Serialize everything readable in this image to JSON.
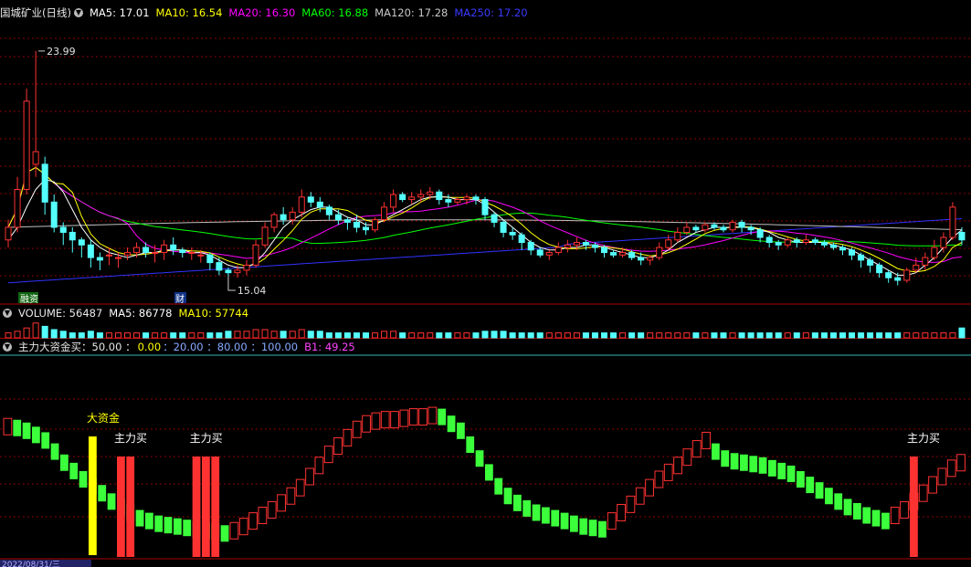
{
  "colors": {
    "up": "#ff3232",
    "down": "#54ffff",
    "ma5": "#ffffff",
    "ma10": "#ffff00",
    "ma20": "#ff00ff",
    "ma60": "#00ff00",
    "ma120": "#c0c0c0",
    "ma250": "#3232ff",
    "bull": "#ff3232",
    "bear": "#3cff3c",
    "bigfund": "#ffff00"
  },
  "header": {
    "title": "国城矿业(日线)",
    "ma5": "MA5: 17.01",
    "ma10": "MA10: 16.54",
    "ma20": "MA20: 16.30",
    "ma60": "MA60: 16.88",
    "ma120": "MA120: 17.28",
    "ma250": "MA250: 17.20"
  },
  "annotations": {
    "high": "23.99",
    "low": "15.04",
    "tag1": "融资",
    "tag2": "财"
  },
  "volume_header": {
    "label": "VOLUME: 56487",
    "ma5": "MA5: 86778",
    "ma10": "MA10: 57744"
  },
  "indicator_header": {
    "label": "主力大资金买：50.00 ：",
    "v1": "0.00",
    "v2": "：20.00 ：80.00 ：100.00",
    "b1": "B1: 49.25"
  },
  "indicator_labels": {
    "big": "大资金",
    "buy": "主力买"
  },
  "axis": {
    "date": "2022/08/31/三"
  },
  "chart_data": [
    {
      "type": "candlestick",
      "ylim": [
        14.5,
        25
      ],
      "candles": [
        [
          16.5,
          17,
          16.2,
          17.3
        ],
        [
          17,
          18.5,
          16.8,
          19
        ],
        [
          18.5,
          22,
          18.3,
          22.5
        ],
        [
          19.5,
          20,
          19,
          23.99
        ],
        [
          19.5,
          18,
          17.5,
          19.8
        ],
        [
          18,
          17,
          16.8,
          18.3
        ],
        [
          17,
          16.8,
          16.3,
          17.2
        ],
        [
          16.8,
          16.5,
          16,
          17
        ],
        [
          16.5,
          16.3,
          15.8,
          16.6
        ],
        [
          16.3,
          15.8,
          15.4,
          16.5
        ],
        [
          15.8,
          15.7,
          15.3,
          16
        ],
        [
          15.9,
          15.9,
          15.5,
          16.2
        ],
        [
          15.8,
          15.8,
          15.4,
          16
        ],
        [
          15.9,
          16,
          15.7,
          16.2
        ],
        [
          16,
          16.2,
          15.8,
          16.4
        ],
        [
          16.2,
          16,
          15.8,
          16.4
        ],
        [
          16,
          16,
          15.6,
          16.3
        ],
        [
          16,
          16.3,
          15.7,
          16.5
        ],
        [
          16.3,
          16.1,
          15.9,
          16.6
        ],
        [
          16.1,
          16,
          15.8,
          16.2
        ],
        [
          16,
          16,
          15.7,
          16.2
        ],
        [
          15.9,
          15.9,
          15.6,
          16.1
        ],
        [
          15.9,
          15.6,
          15.3,
          16
        ],
        [
          15.6,
          15.3,
          15.1,
          15.8
        ],
        [
          15.3,
          15.2,
          15.04,
          15.4
        ],
        [
          15.2,
          15.3,
          15,
          15.5
        ],
        [
          15.3,
          15.5,
          15.1,
          15.7
        ],
        [
          15.5,
          16.3,
          15.4,
          16.5
        ],
        [
          16.3,
          17,
          16.2,
          17.2
        ],
        [
          17,
          17.5,
          16.8,
          17.6
        ],
        [
          17.5,
          17.3,
          17.1,
          17.8
        ],
        [
          17.3,
          17.6,
          17.1,
          17.8
        ],
        [
          17.6,
          18.2,
          17.4,
          18.5
        ],
        [
          18.2,
          18,
          17.8,
          18.4
        ],
        [
          18,
          17.8,
          17.6,
          18.2
        ],
        [
          17.8,
          17.5,
          17.3,
          17.9
        ],
        [
          17.5,
          17.3,
          17.1,
          17.7
        ],
        [
          17.3,
          17.2,
          16.9,
          17.4
        ],
        [
          17.2,
          17,
          16.8,
          17.5
        ],
        [
          17,
          16.9,
          16.7,
          17.2
        ],
        [
          16.9,
          17.3,
          16.8,
          17.4
        ],
        [
          17.3,
          17.8,
          17.2,
          18
        ],
        [
          17.8,
          18.3,
          17.6,
          18.5
        ],
        [
          18.3,
          18.1,
          18,
          18.4
        ],
        [
          18.1,
          18.2,
          17.9,
          18.4
        ],
        [
          18.2,
          18.3,
          18,
          18.5
        ],
        [
          18.3,
          18.4,
          18.1,
          18.6
        ],
        [
          18.4,
          18.1,
          17.9,
          18.5
        ],
        [
          18.1,
          18,
          17.8,
          18.3
        ],
        [
          18,
          18.1,
          17.9,
          18.2
        ],
        [
          18.1,
          18.2,
          17.9,
          18.3
        ],
        [
          18.2,
          18.1,
          17.9,
          18.3
        ],
        [
          18.1,
          17.5,
          17.3,
          18.2
        ],
        [
          17.5,
          17.2,
          17,
          17.6
        ],
        [
          17.2,
          16.8,
          16.6,
          17.3
        ],
        [
          16.8,
          16.7,
          16.5,
          17
        ],
        [
          16.7,
          16.4,
          16.1,
          16.8
        ],
        [
          16.4,
          16.1,
          15.9,
          16.5
        ],
        [
          16.1,
          15.9,
          15.8,
          16.2
        ],
        [
          15.9,
          16,
          15.7,
          16.1
        ],
        [
          16,
          16.2,
          15.9,
          16.4
        ],
        [
          16.2,
          16.3,
          16,
          16.5
        ],
        [
          16.3,
          16.4,
          16.1,
          16.6
        ],
        [
          16.4,
          16.3,
          16.1,
          16.5
        ],
        [
          16.3,
          16.2,
          16,
          16.4
        ],
        [
          16.2,
          16,
          15.8,
          16.3
        ],
        [
          16,
          15.9,
          15.8,
          16.1
        ],
        [
          15.9,
          16,
          15.8,
          16.2
        ],
        [
          16,
          15.8,
          15.7,
          16.1
        ],
        [
          15.8,
          15.7,
          15.5,
          16
        ],
        [
          15.7,
          15.8,
          15.5,
          15.9
        ],
        [
          15.8,
          16.2,
          15.7,
          16.4
        ],
        [
          16.2,
          16.5,
          16.1,
          16.7
        ],
        [
          16.5,
          16.8,
          16.4,
          17
        ],
        [
          16.8,
          17,
          16.7,
          17.2
        ],
        [
          17,
          16.9,
          16.8,
          17.1
        ],
        [
          16.9,
          17.1,
          16.8,
          17.2
        ],
        [
          17.1,
          17,
          16.9,
          17.2
        ],
        [
          17,
          16.9,
          16.8,
          17.1
        ],
        [
          16.9,
          17.2,
          16.8,
          17.3
        ],
        [
          17.2,
          17,
          16.8,
          17.3
        ],
        [
          17,
          16.9,
          16.7,
          17.1
        ],
        [
          16.9,
          16.6,
          16.4,
          17
        ],
        [
          16.6,
          16.4,
          16.2,
          16.7
        ],
        [
          16.4,
          16.3,
          16.1,
          16.5
        ],
        [
          16.3,
          16.5,
          16.2,
          16.6
        ],
        [
          16.5,
          16.4,
          16.2,
          16.6
        ],
        [
          16.4,
          16.5,
          16.3,
          16.7
        ],
        [
          16.5,
          16.4,
          16.3,
          16.6
        ],
        [
          16.4,
          16.3,
          16.2,
          16.5
        ],
        [
          16.3,
          16.2,
          16.1,
          16.4
        ],
        [
          16.2,
          16.1,
          15.9,
          16.3
        ],
        [
          16.1,
          15.9,
          15.7,
          16.2
        ],
        [
          15.9,
          15.7,
          15.4,
          16
        ],
        [
          15.7,
          15.5,
          15.2,
          15.8
        ],
        [
          15.5,
          15.2,
          15,
          15.6
        ],
        [
          15.2,
          15,
          14.8,
          15.3
        ],
        [
          15,
          14.9,
          14.7,
          15.2
        ],
        [
          14.9,
          15.3,
          14.8,
          15.4
        ],
        [
          15.3,
          15.5,
          15.2,
          15.8
        ],
        [
          15.5,
          15.8,
          15.3,
          16
        ],
        [
          15.8,
          16.2,
          15.7,
          16.5
        ],
        [
          16.2,
          16.6,
          16,
          16.8
        ],
        [
          16.6,
          17.8,
          16.5,
          18
        ],
        [
          16.8,
          16.5,
          16.3,
          17
        ]
      ],
      "ma5": [
        16.5,
        17,
        17.8,
        18.5,
        18.9,
        18.8,
        18.4,
        17.7,
        17,
        16.5,
        16.2,
        16,
        15.9,
        15.8,
        15.9,
        16,
        16,
        16.1,
        16.1,
        16.1,
        16,
        16,
        15.9,
        15.7,
        15.5,
        15.4,
        15.4,
        15.6,
        16,
        16.5,
        17,
        17.3,
        17.5,
        17.7,
        17.8,
        17.8,
        17.6,
        17.4,
        17.3,
        17.1,
        17.1,
        17.3,
        17.5,
        17.7,
        17.9,
        18.1,
        18.2,
        18.2,
        18.2,
        18.1,
        18.1,
        18.1,
        17.9,
        17.6,
        17.3,
        17,
        16.7,
        16.4,
        16.2,
        16.1,
        16.1,
        16.2,
        16.2,
        16.3,
        16.3,
        16.2,
        16.1,
        16,
        15.9,
        15.8,
        15.8,
        15.9,
        16.1,
        16.4,
        16.6,
        16.8,
        16.9,
        17,
        17,
        17,
        17,
        17,
        16.9,
        16.8,
        16.6,
        16.5,
        16.4,
        16.4,
        16.4,
        16.4,
        16.3,
        16.2,
        16.1,
        15.9,
        15.7,
        15.5,
        15.3,
        15.1,
        15.1,
        15.2,
        15.5,
        15.8,
        16.2,
        16.6,
        16.9
      ]
    },
    {
      "type": "bar",
      "name": "VOLUME",
      "values": [
        3,
        4,
        6,
        9,
        7,
        5,
        4,
        3,
        3,
        4,
        3,
        3,
        3,
        3,
        3,
        3,
        3,
        3,
        3,
        3,
        3,
        3,
        3,
        3,
        4,
        4,
        4,
        5,
        5,
        4,
        4,
        4,
        5,
        4,
        4,
        3,
        3,
        3,
        3,
        3,
        3,
        4,
        4,
        3,
        3,
        3,
        3,
        3,
        3,
        3,
        3,
        3,
        4,
        4,
        4,
        3,
        3,
        3,
        3,
        3,
        3,
        3,
        3,
        3,
        3,
        3,
        3,
        3,
        3,
        3,
        3,
        3,
        3,
        3,
        3,
        3,
        3,
        3,
        3,
        3,
        3,
        3,
        3,
        3,
        3,
        3,
        3,
        3,
        3,
        3,
        3,
        3,
        3,
        3,
        3,
        3,
        3,
        3,
        3,
        3,
        3,
        3,
        3,
        3,
        6
      ]
    },
    {
      "type": "bar",
      "name": "主力大资金买",
      "ylim": [
        0,
        100
      ],
      "values": [
        88,
        87,
        85,
        82,
        78,
        70,
        62,
        56,
        50,
        45,
        40,
        34,
        30,
        26,
        22,
        20,
        18,
        17,
        16,
        15,
        14,
        13,
        12,
        11,
        13,
        16,
        20,
        24,
        28,
        33,
        38,
        44,
        52,
        60,
        68,
        74,
        80,
        86,
        90,
        92,
        93,
        93,
        94,
        95,
        95,
        96,
        95,
        90,
        85,
        75,
        65,
        55,
        45,
        38,
        33,
        29,
        26,
        24,
        22,
        20,
        18,
        16,
        15,
        14,
        20,
        26,
        32,
        38,
        44,
        50,
        55,
        60,
        66,
        72,
        78,
        70,
        65,
        63,
        62,
        61,
        60,
        58,
        56,
        54,
        50,
        46,
        42,
        38,
        34,
        30,
        27,
        24,
        22,
        20,
        24,
        28,
        34,
        40,
        46,
        52,
        58,
        62
      ],
      "markers": {
        "big": [
          9
        ],
        "buy": [
          12,
          13,
          20,
          21,
          22,
          96
        ]
      },
      "b1": 49.25
    }
  ]
}
